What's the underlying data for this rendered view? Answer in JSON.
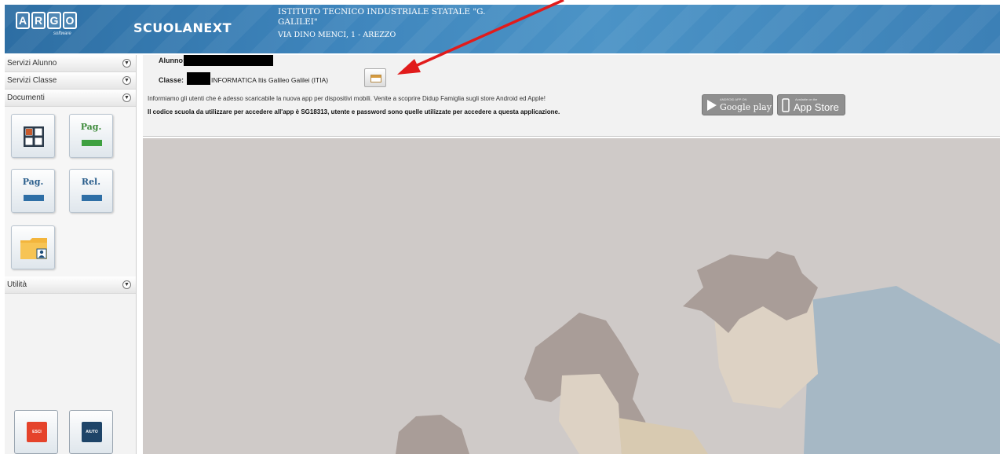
{
  "header": {
    "logo_letters": [
      "A",
      "R",
      "G",
      "O"
    ],
    "logo_sub": "software",
    "app_name": "SCUOLANEXT",
    "school_name": "ISTITUTO TECNICO INDUSTRIALE STATALE \"G. GALILEI\"",
    "school_address": "VIA DINO MENCI, 1 - AREZZO"
  },
  "sidebar": {
    "menus": [
      {
        "label": "Servizi Alunno"
      },
      {
        "label": "Servizi Classe"
      },
      {
        "label": "Documenti"
      }
    ],
    "documents": [
      {
        "label": "",
        "icon": "grid-icon"
      },
      {
        "label": "Pag.",
        "icon": "green-bar-icon"
      },
      {
        "label": "Pag.",
        "icon": "blue-bar-icon"
      },
      {
        "label": "Rel.",
        "icon": "blue-bar-icon"
      },
      {
        "label": "",
        "icon": "folder-user-icon"
      }
    ],
    "utility_label": "Utilità",
    "footer": {
      "exit_label": "ESCI",
      "help_label": "AIUTO"
    }
  },
  "info": {
    "student_label": "Alunno:",
    "class_label": "Classe:",
    "class_value": "INFORMATICA Itis Galileo Galilei (ITIA)",
    "notice_line1": "Informiamo gli utenti che è adesso scaricabile la nuova app per dispositivi mobili. Venite a scoprire Didup Famiglia sugli store Android ed Apple!",
    "notice_line2": "Il codice scuola da utilizzare per accedere all'app è SG18313, utente e password sono quelle utilizzate per accedere a questa applicazione.",
    "google_play_sub": "ANDROID APP ON",
    "google_play_label": "Google play",
    "app_store_sub": "Available on the",
    "app_store_label": "App Store"
  },
  "colors": {
    "header_blue": "#3f86bd",
    "arrow_red": "#e11b1b",
    "main_bg": "#cfcac8",
    "exit_red": "#e5432b",
    "help_navy": "#1e4468"
  }
}
